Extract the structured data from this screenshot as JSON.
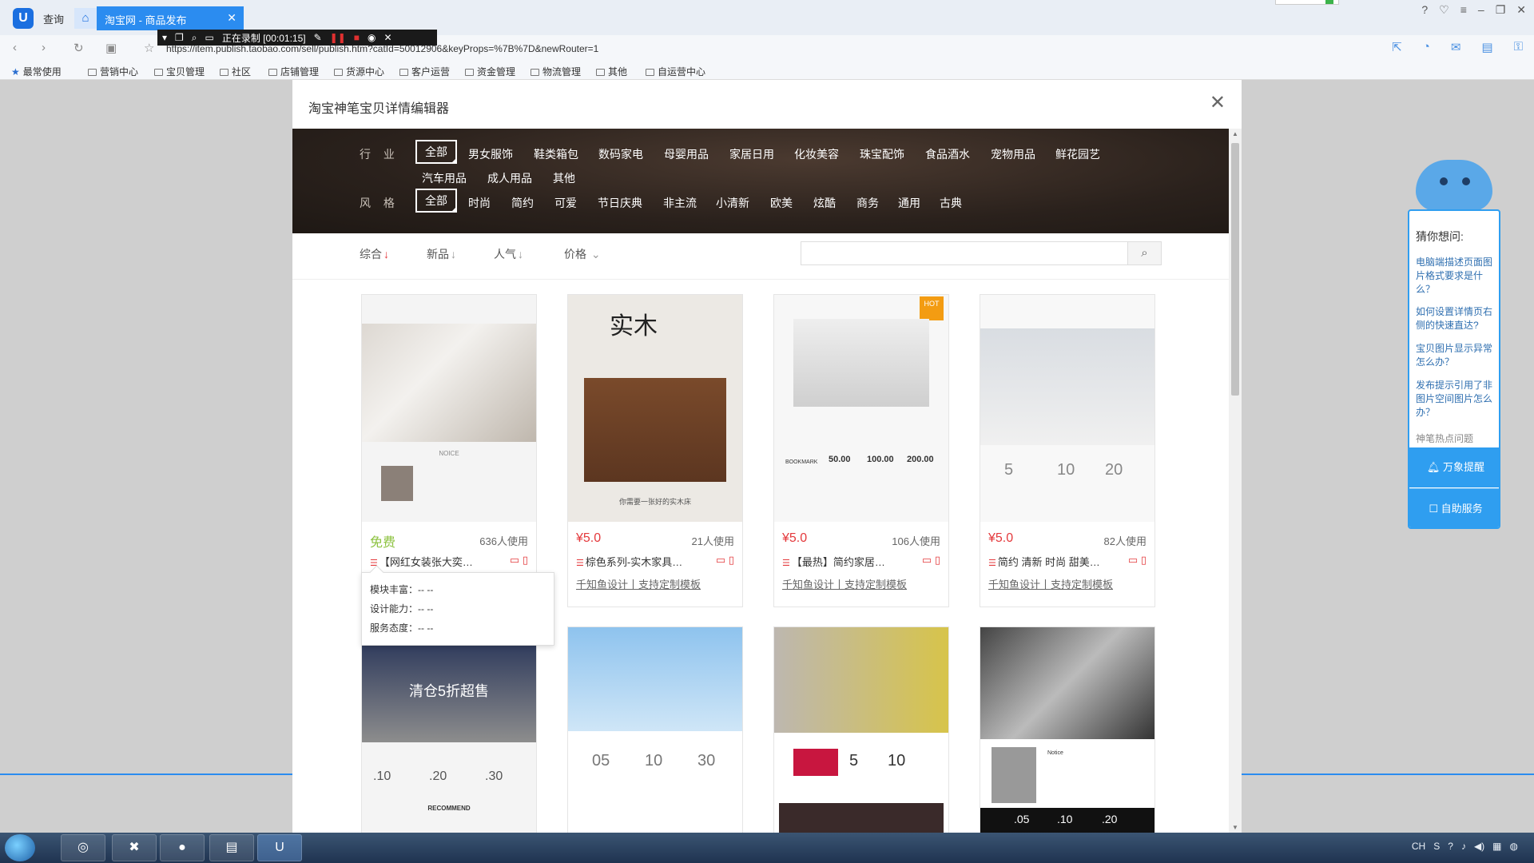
{
  "browser": {
    "tab_query": "查询",
    "active_tab": "淘宝网 - 商品发布",
    "url": "https://item.publish.taobao.com/sell/publish.htm?catId=50012906&keyProps=%7B%7D&newRouter=1",
    "recording_label": "正在录制 [00:01:15]",
    "bookmarks": [
      "最常使用",
      "营销中心",
      "宝贝管理",
      "社区",
      "店铺管理",
      "货源中心",
      "客户运营",
      "资金管理",
      "物流管理",
      "其他",
      "自运营中心"
    ]
  },
  "modal": {
    "title": "淘宝神笔宝贝详情编辑器",
    "filters": {
      "industry_label": "行 业",
      "industry": [
        "全部",
        "男女服饰",
        "鞋类箱包",
        "数码家电",
        "母婴用品",
        "家居日用",
        "化妆美容",
        "珠宝配饰",
        "食品酒水",
        "宠物用品",
        "鲜花园艺",
        "汽车用品",
        "成人用品",
        "其他"
      ],
      "style_label": "风 格",
      "style": [
        "全部",
        "时尚",
        "简约",
        "可爱",
        "节日庆典",
        "非主流",
        "小清新",
        "欧美",
        "炫酷",
        "商务",
        "通用",
        "古典"
      ]
    },
    "sort": {
      "items": [
        "综合",
        "新品",
        "人气",
        "价格"
      ],
      "search_placeholder": ""
    },
    "templates": [
      {
        "price": "免费",
        "users": "636人使用",
        "name": "【网红女装张大奕…",
        "designer": ""
      },
      {
        "price": "¥5.0",
        "users": "21人使用",
        "name": "棕色系列-实木家具…",
        "designer": "千知鱼设计丨支持定制模板"
      },
      {
        "price": "¥5.0",
        "users": "106人使用",
        "name": "【最热】简约家居…",
        "designer": "千知鱼设计丨支持定制模板"
      },
      {
        "price": "¥5.0",
        "users": "82人使用",
        "name": "简约 清新 时尚 甜美…",
        "designer": "千知鱼设计丨支持定制模板"
      }
    ],
    "thumb_texts": {
      "t1_brand": "NOICE",
      "t2_title": "实木",
      "t2_sub": "你需要一张好的实木床",
      "t3_hot": "HOT",
      "t3_prices": [
        "50.00",
        "100.00",
        "200.00"
      ],
      "t3_label": "BOOKMARK",
      "t4_nums": [
        "5",
        "10",
        "20"
      ],
      "t5_text": "清仓5折超售",
      "t5_nums": [
        ".10",
        ".20",
        ".30"
      ],
      "t5_footer": "RECOMMEND",
      "t6_nums": [
        "05",
        "10",
        "30"
      ],
      "t7_nums": [
        "5",
        "10"
      ],
      "t8_nums": [
        ".05",
        ".10",
        ".20"
      ],
      "t8_label": "Notice"
    },
    "tooltip": {
      "rows": [
        "模块丰富：-- --",
        "设计能力：-- --",
        "服务态度：-- --"
      ]
    }
  },
  "help_panel": {
    "title": "猜你想问:",
    "questions": [
      "电脑端描述页面图片格式要求是什么？",
      "如何设置详情页右侧的快速直达?",
      "宝贝图片显示异常怎么办？",
      "发布提示引用了非图片空间图片怎么办？"
    ],
    "hot": "神笔热点问题",
    "btn_remind": "万象提醒",
    "btn_service": "自助服务"
  },
  "colors": {
    "accent_blue": "#2b8cf0",
    "price_red": "#e4393c",
    "free_green": "#8cc23f",
    "filter_bg": "#2a211c"
  }
}
